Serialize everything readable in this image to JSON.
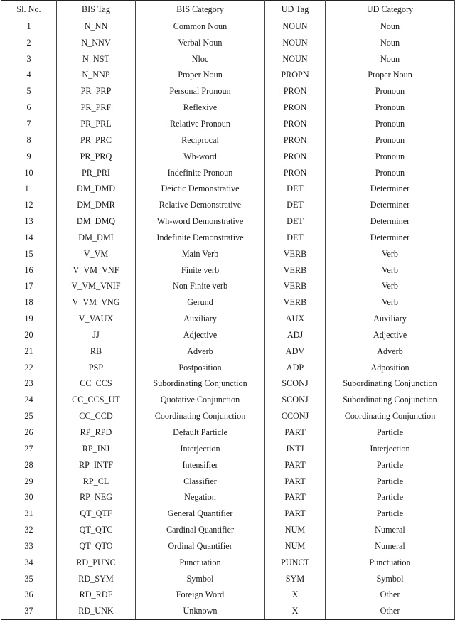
{
  "table": {
    "headers": [
      "Sl. No.",
      "BIS Tag",
      "BIS Category",
      "UD Tag",
      "UD Category"
    ],
    "rows": [
      [
        "1",
        "N_NN",
        "Common Noun",
        "NOUN",
        "Noun"
      ],
      [
        "2",
        "N_NNV",
        "Verbal Noun",
        "NOUN",
        "Noun"
      ],
      [
        "3",
        "N_NST",
        "Nloc",
        "NOUN",
        "Noun"
      ],
      [
        "4",
        "N_NNP",
        "Proper Noun",
        "PROPN",
        "Proper Noun"
      ],
      [
        "5",
        "PR_PRP",
        "Personal Pronoun",
        "PRON",
        "Pronoun"
      ],
      [
        "6",
        "PR_PRF",
        "Reflexive",
        "PRON",
        "Pronoun"
      ],
      [
        "7",
        "PR_PRL",
        "Relative Pronoun",
        "PRON",
        "Pronoun"
      ],
      [
        "8",
        "PR_PRC",
        "Reciprocal",
        "PRON",
        "Pronoun"
      ],
      [
        "9",
        "PR_PRQ",
        "Wh-word",
        "PRON",
        "Pronoun"
      ],
      [
        "10",
        "PR_PRI",
        "Indefinite Pronoun",
        "PRON",
        "Pronoun"
      ],
      [
        "11",
        "DM_DMD",
        "Deictic Demonstrative",
        "DET",
        "Determiner"
      ],
      [
        "12",
        "DM_DMR",
        "Relative Demonstrative",
        "DET",
        "Determiner"
      ],
      [
        "13",
        "DM_DMQ",
        "Wh-word Demonstrative",
        "DET",
        "Determiner"
      ],
      [
        "14",
        "DM_DMI",
        "Indefinite Demonstrative",
        "DET",
        "Determiner"
      ],
      [
        "15",
        "V_VM",
        "Main Verb",
        "VERB",
        "Verb"
      ],
      [
        "16",
        "V_VM_VNF",
        "Finite verb",
        "VERB",
        "Verb"
      ],
      [
        "17",
        "V_VM_VNIF",
        "Non Finite verb",
        "VERB",
        "Verb"
      ],
      [
        "18",
        "V_VM_VNG",
        "Gerund",
        "VERB",
        "Verb"
      ],
      [
        "19",
        "V_VAUX",
        "Auxiliary",
        "AUX",
        "Auxiliary"
      ],
      [
        "20",
        "JJ",
        "Adjective",
        "ADJ",
        "Adjective"
      ],
      [
        "21",
        "RB",
        "Adverb",
        "ADV",
        "Adverb"
      ],
      [
        "22",
        "PSP",
        "Postposition",
        "ADP",
        "Adposition"
      ],
      [
        "23",
        "CC_CCS",
        "Subordinating Conjunction",
        "SCONJ",
        "Subordinating Conjunction"
      ],
      [
        "24",
        "CC_CCS_UT",
        "Quotative Conjunction",
        "SCONJ",
        "Subordinating Conjunction"
      ],
      [
        "25",
        "CC_CCD",
        "Coordinating Conjunction",
        "CCONJ",
        "Coordinating Conjunction"
      ],
      [
        "26",
        "RP_RPD",
        "Default Particle",
        "PART",
        "Particle"
      ],
      [
        "27",
        "RP_INJ",
        "Interjection",
        "INTJ",
        "Interjection"
      ],
      [
        "28",
        "RP_INTF",
        "Intensifier",
        "PART",
        "Particle"
      ],
      [
        "29",
        "RP_CL",
        "Classifier",
        "PART",
        "Particle"
      ],
      [
        "30",
        "RP_NEG",
        "Negation",
        "PART",
        "Particle"
      ],
      [
        "31",
        "QT_QTF",
        "General Quantifier",
        "PART",
        "Particle"
      ],
      [
        "32",
        "QT_QTC",
        "Cardinal Quantifier",
        "NUM",
        "Numeral"
      ],
      [
        "33",
        "QT_QTO",
        "Ordinal Quantifier",
        "NUM",
        "Numeral"
      ],
      [
        "34",
        "RD_PUNC",
        "Punctuation",
        "PUNCT",
        "Punctuation"
      ],
      [
        "35",
        "RD_SYM",
        "Symbol",
        "SYM",
        "Symbol"
      ],
      [
        "36",
        "RD_RDF",
        "Foreign Word",
        "X",
        "Other"
      ],
      [
        "37",
        "RD_UNK",
        "Unknown",
        "X",
        "Other"
      ]
    ]
  }
}
